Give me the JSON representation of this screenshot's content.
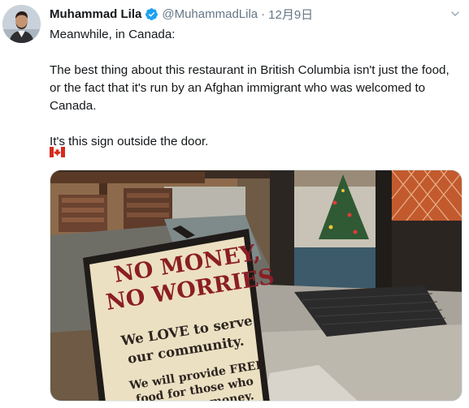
{
  "tweet": {
    "author": {
      "name": "Muhammad Lila",
      "handle": "@MuhammadLila",
      "verified": true
    },
    "separator": "·",
    "date": "12月9日",
    "text": {
      "line1": "Meanwhile, in Canada:",
      "paragraph2": "The best thing about this restaurant in British Columbia isn't just the food, or the fact that it's run by an Afghan immigrant who was welcomed to Canada.",
      "paragraph3": "It's this sign outside the door."
    },
    "emoji": "canada-flag-icon",
    "media": {
      "sign": {
        "line1": "NO MONEY,",
        "line2": "NO WORRIES",
        "line3": "We LOVE to serve",
        "line4": "our community.",
        "line5": "We will provide FREE",
        "line6": "food for those who",
        "line7": "don't have money."
      }
    }
  },
  "colors": {
    "text": "#14171a",
    "secondary": "#657786",
    "verified": "#1da1f2",
    "sign_red": "#8a1e24",
    "sign_bg": "#ece0c2"
  },
  "icons": {
    "verified": "verified-badge-icon",
    "menu": "chevron-down-icon",
    "flag": "canada-flag-icon"
  }
}
